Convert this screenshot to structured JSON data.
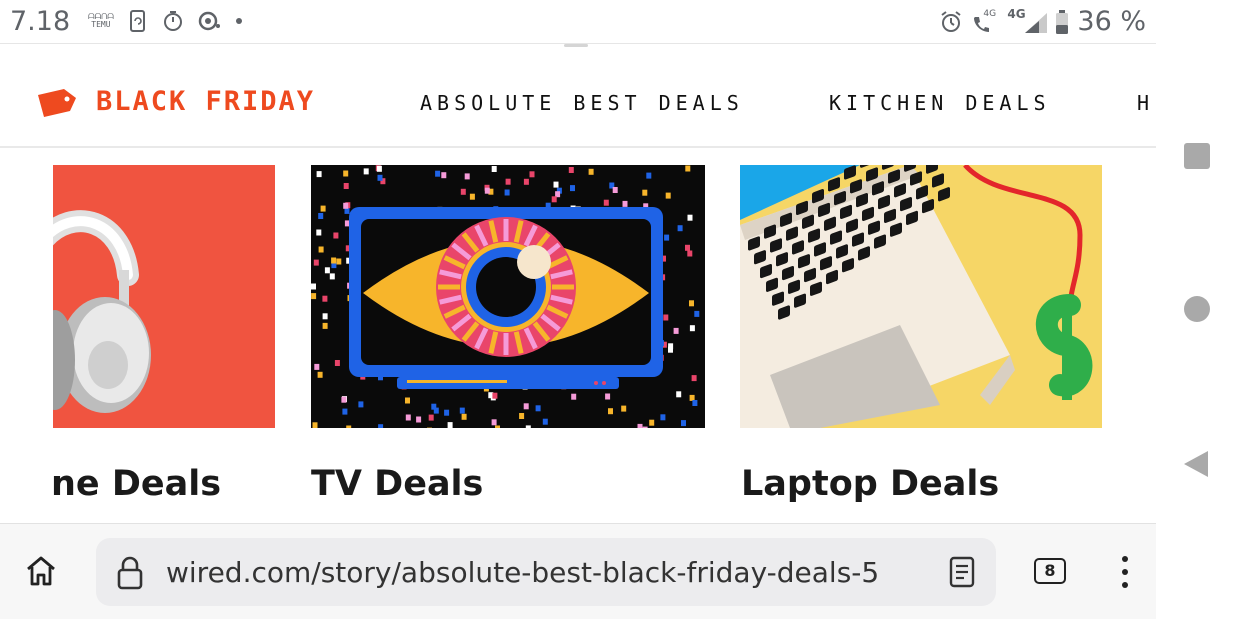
{
  "status_bar": {
    "time": "7.18",
    "temu_label_top": "ᗩᗩᑎᗩ",
    "temu_label_bottom": "TEMU",
    "network_4g": "4G",
    "network_4g_plus": "4G",
    "battery_percent": "36 %"
  },
  "header": {
    "brand_label": "BLACK FRIDAY",
    "nav": [
      "ABSOLUTE BEST DEALS",
      "KITCHEN DEALS",
      "H"
    ]
  },
  "cards": [
    {
      "title": "ne Deals"
    },
    {
      "title": "TV Deals"
    },
    {
      "title": "Laptop Deals"
    }
  ],
  "browser": {
    "url": "wired.com/story/absolute-best-black-friday-deals-5",
    "tab_count": "8"
  },
  "colors": {
    "brand_orange": "#ee4a1f",
    "headphones_bg": "#f05440",
    "laptop_bg": "#f6d666"
  },
  "icons": {
    "home": "home-icon",
    "lock": "lock-icon",
    "reader": "reader-mode-icon",
    "tabs": "tabs-icon",
    "menu": "more-vert-icon"
  }
}
